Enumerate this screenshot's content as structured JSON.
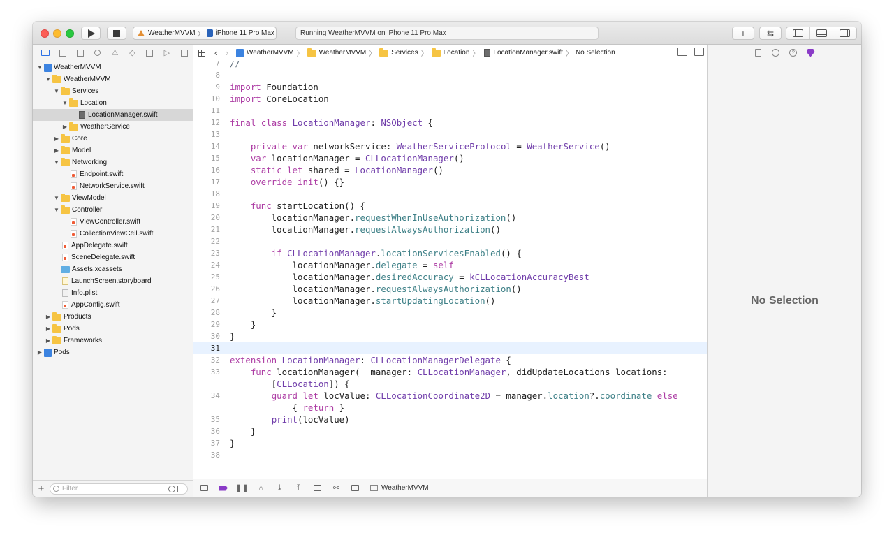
{
  "toolbar": {
    "scheme_app": "WeatherMVVM",
    "scheme_device": "iPhone 11 Pro Max",
    "activity_status": "Running WeatherMVVM on iPhone 11 Pro Max"
  },
  "navigator": {
    "filter_placeholder": "Filter",
    "tree": [
      {
        "label": "WeatherMVVM",
        "level": 0,
        "icon": "project",
        "disclosure": "open"
      },
      {
        "label": "WeatherMVVM",
        "level": 1,
        "icon": "folder",
        "disclosure": "open"
      },
      {
        "label": "Services",
        "level": 2,
        "icon": "folder",
        "disclosure": "open"
      },
      {
        "label": "Location",
        "level": 3,
        "icon": "folder",
        "disclosure": "open"
      },
      {
        "label": "LocationManager.swift",
        "level": 4,
        "icon": "swiftdark",
        "disclosure": "",
        "selected": true
      },
      {
        "label": "WeatherService",
        "level": 3,
        "icon": "folder",
        "disclosure": "closed"
      },
      {
        "label": "Core",
        "level": 2,
        "icon": "folder",
        "disclosure": "closed"
      },
      {
        "label": "Model",
        "level": 2,
        "icon": "folder",
        "disclosure": "closed"
      },
      {
        "label": "Networking",
        "level": 2,
        "icon": "folder",
        "disclosure": "open"
      },
      {
        "label": "Endpoint.swift",
        "level": 3,
        "icon": "swift",
        "disclosure": ""
      },
      {
        "label": "NetworkService.swift",
        "level": 3,
        "icon": "swift",
        "disclosure": ""
      },
      {
        "label": "ViewModel",
        "level": 2,
        "icon": "folder",
        "disclosure": "open"
      },
      {
        "label": "Controller",
        "level": 2,
        "icon": "folder",
        "disclosure": "open"
      },
      {
        "label": "ViewController.swift",
        "level": 3,
        "icon": "swift",
        "disclosure": ""
      },
      {
        "label": "CollectionViewCell.swift",
        "level": 3,
        "icon": "swift",
        "disclosure": ""
      },
      {
        "label": "AppDelegate.swift",
        "level": 2,
        "icon": "swift",
        "disclosure": ""
      },
      {
        "label": "SceneDelegate.swift",
        "level": 2,
        "icon": "swift",
        "disclosure": ""
      },
      {
        "label": "Assets.xcassets",
        "level": 2,
        "icon": "assets",
        "disclosure": ""
      },
      {
        "label": "LaunchScreen.storyboard",
        "level": 2,
        "icon": "storyboard",
        "disclosure": ""
      },
      {
        "label": "Info.plist",
        "level": 2,
        "icon": "plist",
        "disclosure": ""
      },
      {
        "label": "AppConfig.swift",
        "level": 2,
        "icon": "swift",
        "disclosure": ""
      },
      {
        "label": "Products",
        "level": 1,
        "icon": "folder",
        "disclosure": "closed"
      },
      {
        "label": "Pods",
        "level": 1,
        "icon": "folder",
        "disclosure": "closed"
      },
      {
        "label": "Frameworks",
        "level": 1,
        "icon": "folder",
        "disclosure": "closed"
      },
      {
        "label": "Pods",
        "level": 0,
        "icon": "project",
        "disclosure": "closed"
      }
    ]
  },
  "jumpbar": {
    "crumbs": [
      {
        "label": "WeatherMVVM",
        "icon": "project"
      },
      {
        "label": "WeatherMVVM",
        "icon": "folder"
      },
      {
        "label": "Services",
        "icon": "folder"
      },
      {
        "label": "Location",
        "icon": "folder"
      },
      {
        "label": "LocationManager.swift",
        "icon": "swiftdark"
      },
      {
        "label": "No Selection",
        "icon": ""
      }
    ]
  },
  "editor": {
    "current_line": "31",
    "lines": [
      {
        "n": "7",
        "code": "//"
      },
      {
        "n": "8",
        "code": ""
      },
      {
        "n": "9",
        "code": "import Foundation"
      },
      {
        "n": "10",
        "code": "import CoreLocation"
      },
      {
        "n": "11",
        "code": ""
      },
      {
        "n": "12",
        "code": "final class LocationManager: NSObject {"
      },
      {
        "n": "13",
        "code": ""
      },
      {
        "n": "14",
        "code": "    private var networkService: WeatherServiceProtocol = WeatherService()"
      },
      {
        "n": "15",
        "code": "    var locationManager = CLLocationManager()"
      },
      {
        "n": "16",
        "code": "    static let shared = LocationManager()"
      },
      {
        "n": "17",
        "code": "    override init() {}"
      },
      {
        "n": "18",
        "code": ""
      },
      {
        "n": "19",
        "code": "    func startLocation() {"
      },
      {
        "n": "20",
        "code": "        locationManager.requestWhenInUseAuthorization()"
      },
      {
        "n": "21",
        "code": "        locationManager.requestAlwaysAuthorization()"
      },
      {
        "n": "22",
        "code": ""
      },
      {
        "n": "23",
        "code": "        if CLLocationManager.locationServicesEnabled() {"
      },
      {
        "n": "24",
        "code": "            locationManager.delegate = self"
      },
      {
        "n": "25",
        "code": "            locationManager.desiredAccuracy = kCLLocationAccuracyBest"
      },
      {
        "n": "26",
        "code": "            locationManager.requestAlwaysAuthorization()"
      },
      {
        "n": "27",
        "code": "            locationManager.startUpdatingLocation()"
      },
      {
        "n": "28",
        "code": "        }"
      },
      {
        "n": "29",
        "code": "    }"
      },
      {
        "n": "30",
        "code": "}"
      },
      {
        "n": "31",
        "code": ""
      },
      {
        "n": "32",
        "code": "extension LocationManager: CLLocationManagerDelegate {"
      },
      {
        "n": "33",
        "code": "    func locationManager(_ manager: CLLocationManager, didUpdateLocations locations:"
      },
      {
        "n": "",
        "code": "        [CLLocation]) {"
      },
      {
        "n": "34",
        "code": "        guard let locValue: CLLocationCoordinate2D = manager.location?.coordinate else"
      },
      {
        "n": "",
        "code": "            { return }"
      },
      {
        "n": "35",
        "code": "        print(locValue)"
      },
      {
        "n": "36",
        "code": "    }"
      },
      {
        "n": "37",
        "code": "}"
      },
      {
        "n": "38",
        "code": ""
      }
    ]
  },
  "debugbar": {
    "target_label": "WeatherMVVM"
  },
  "inspector": {
    "empty_label": "No Selection"
  },
  "colors": {
    "keyword": "#ad3da4",
    "type": "#703daa",
    "property": "#3e8087",
    "accent": "#2c71e6",
    "current_line": "#e8f2ff"
  }
}
